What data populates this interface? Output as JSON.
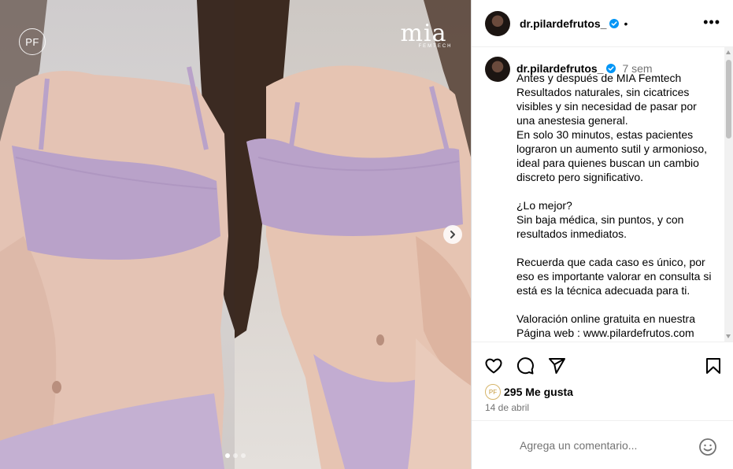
{
  "media": {
    "left_logo_text": "PF",
    "right_logo_text": "mia",
    "right_logo_subtext": "FEMTECH",
    "slides": 3,
    "active_slide": 1
  },
  "header": {
    "username": "dr.pilardefrutos_",
    "separator": "•",
    "more_label": "•••"
  },
  "caption": {
    "username": "dr.pilardefrutos_",
    "time": "7 sem",
    "lines": [
      "Antes y después de MIA Femtech",
      "Resultados naturales, sin cicatrices visibles y sin necesidad de pasar por una anestesia general.",
      "En solo 30 minutos, estas pacientes lograron un aumento sutil y armonioso, ideal para quienes buscan un cambio discreto pero significativo.",
      "",
      "¿Lo mejor?",
      "Sin baja médica, sin puntos, y con resultados inmediatos.",
      "",
      "Recuerda que cada caso es único, por eso es importante valorar en consulta si está es la técnica adecuada para ti.",
      "",
      "Valoración online gratuita en nuestra Página web : www.pilardefrutos.com"
    ]
  },
  "engagement": {
    "likes_avatar_text": "PF",
    "likes": "295 Me gusta",
    "date": "14 de abril"
  },
  "comment": {
    "placeholder": "Agrega un comentario..."
  },
  "icons": {
    "like": "heart-icon",
    "comment": "comment-icon",
    "share": "share-icon",
    "save": "bookmark-icon",
    "emoji": "emoji-icon",
    "next": "chevron-right-icon",
    "verified": "verified-badge-icon"
  },
  "colors": {
    "verified": "#0095f6",
    "secondary_text": "#737373",
    "bikini": "#b9a2c9"
  }
}
